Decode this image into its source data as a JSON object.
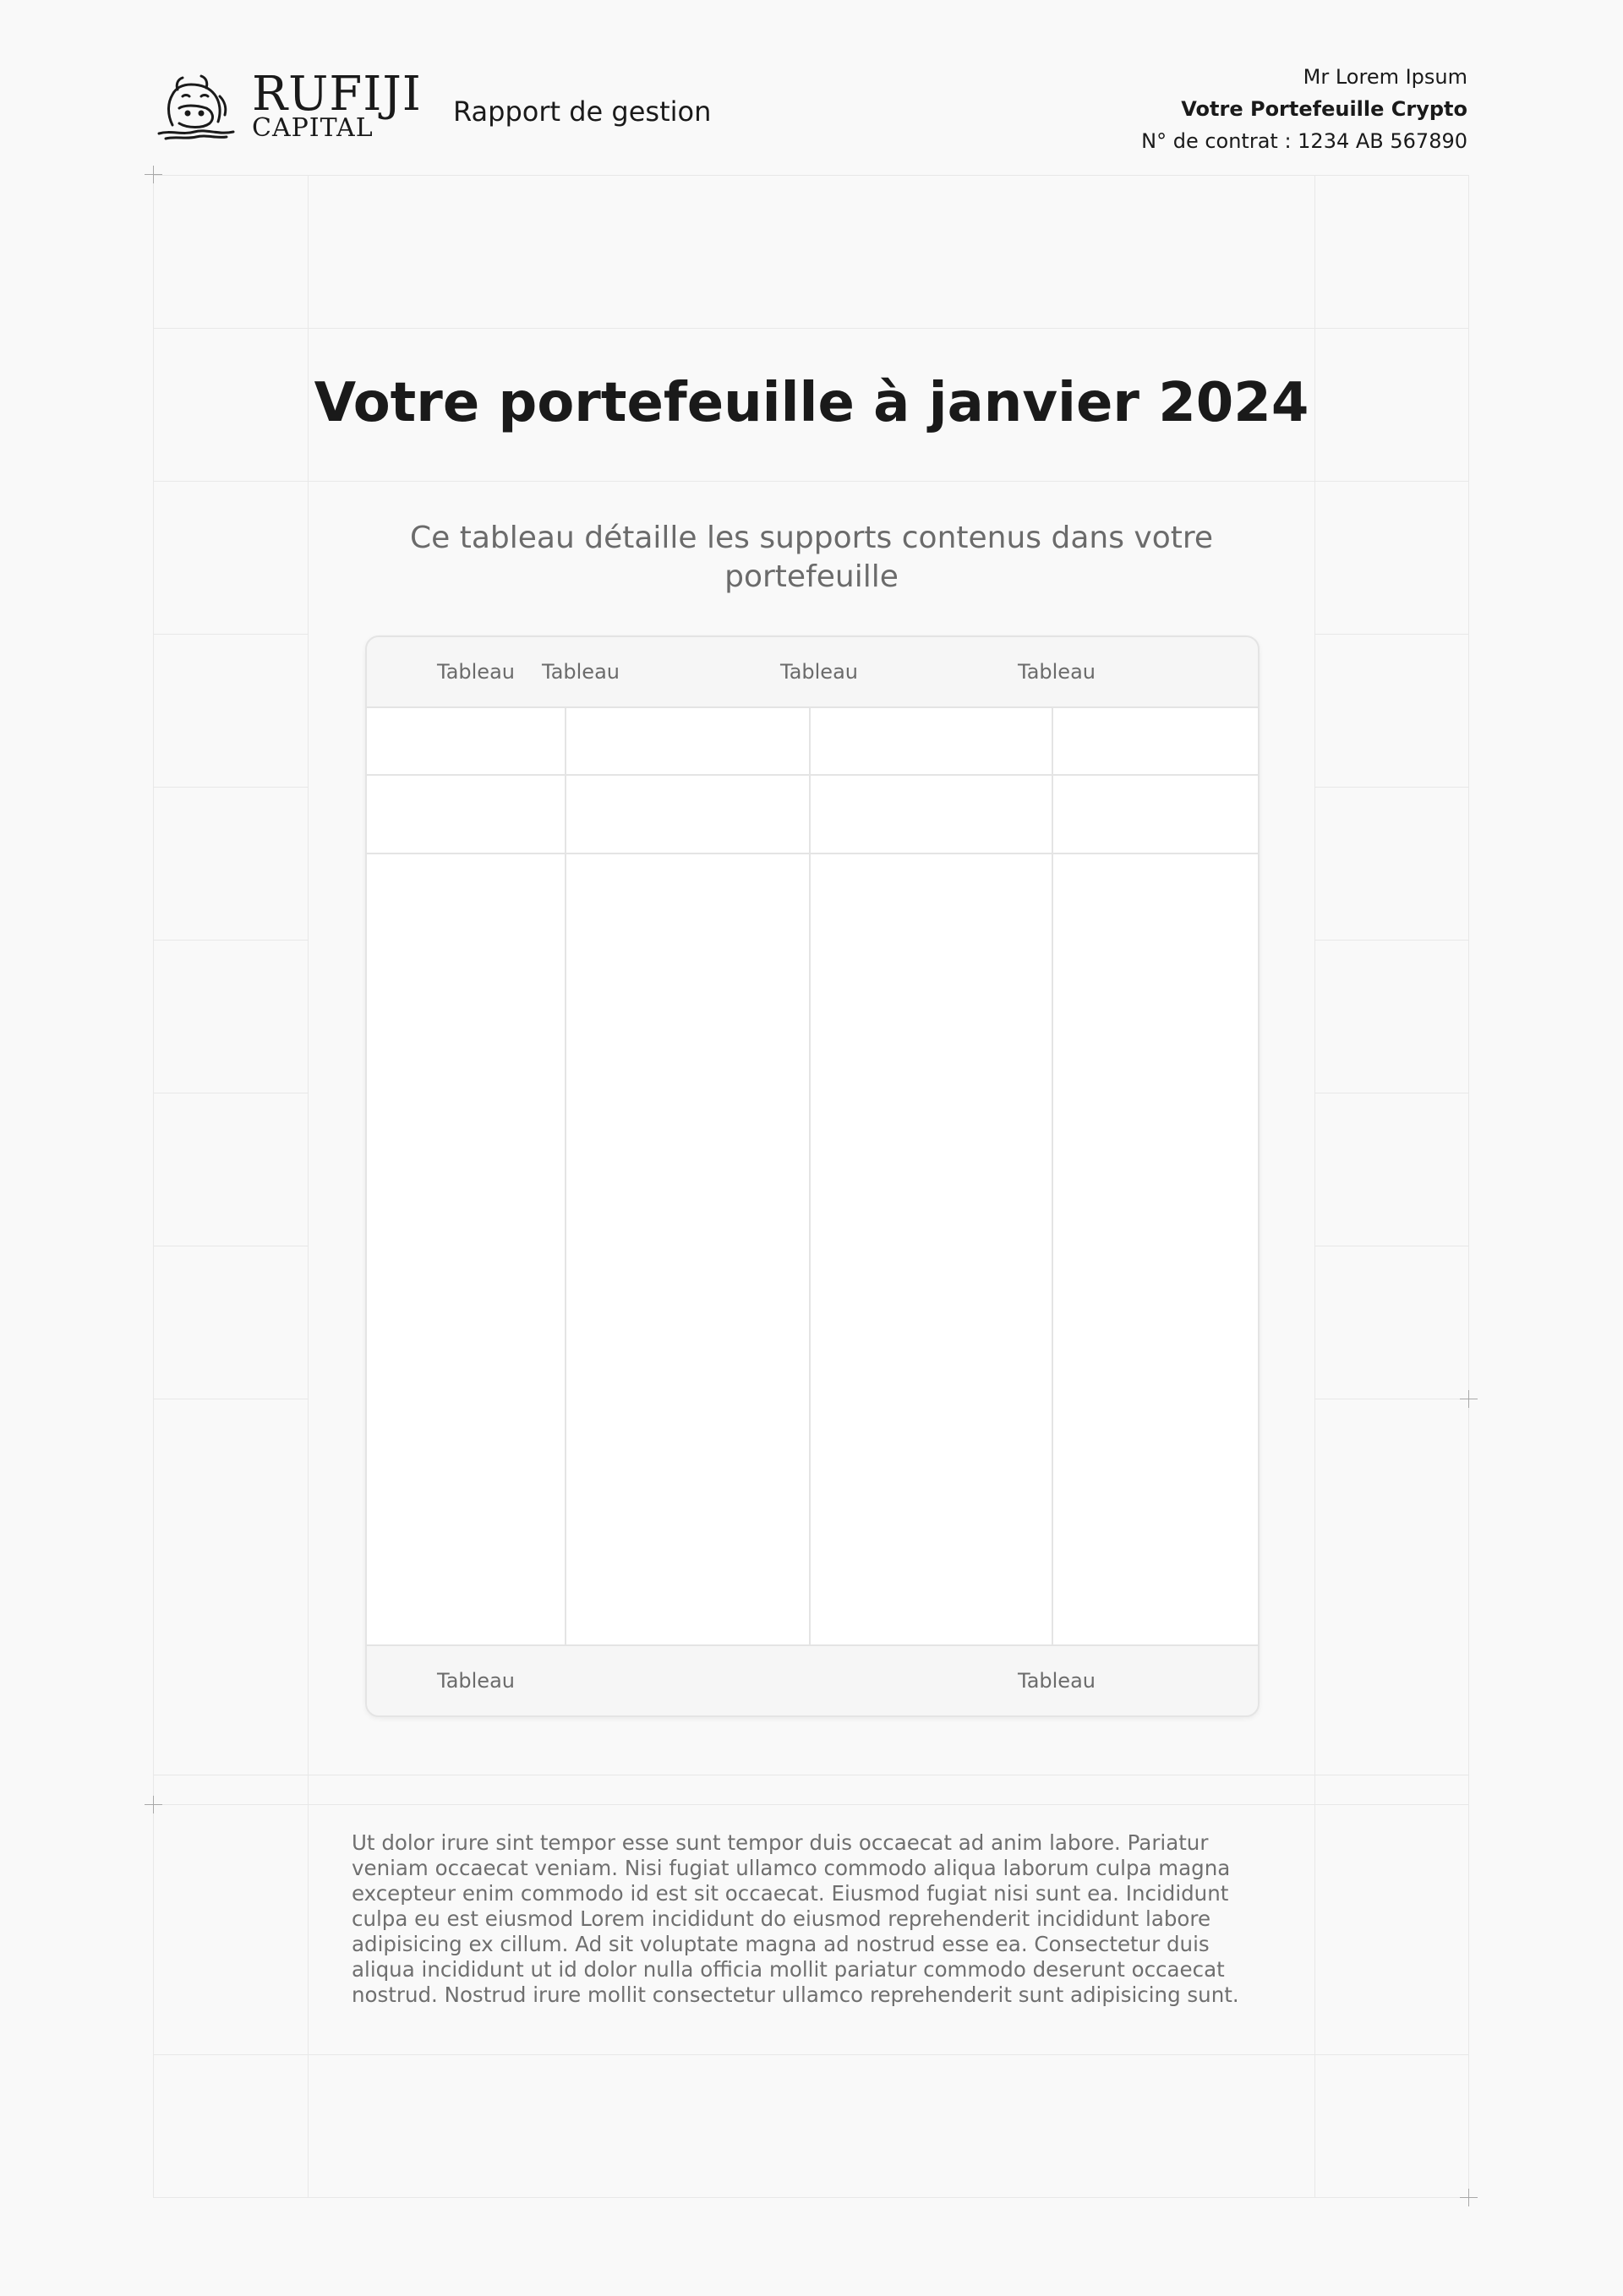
{
  "header": {
    "logo": {
      "word1": "RUFIJI",
      "word2": "CAPITAL",
      "icon": "hippo-logo-icon"
    },
    "report_label": "Rapport de gestion",
    "client": {
      "name": "Mr Lorem Ipsum",
      "portfolio": "Votre Portefeuille Crypto",
      "contract": "N° de contrat : 1234 AB 567890"
    }
  },
  "main": {
    "title": "Votre portefeuille à janvier 2024",
    "subtitle": "Ce tableau détaille les supports contenus dans votre portefeuille"
  },
  "table": {
    "headers": [
      "Tableau",
      "Tableau",
      "Tableau",
      "Tableau"
    ],
    "footer": {
      "left": "Tableau",
      "right": "Tableau"
    }
  },
  "body_text": "Ut dolor irure sint tempor esse sunt tempor duis occaecat ad anim labore. Pariatur veniam occaecat veniam. Nisi fugiat ullamco commodo aliqua laborum culpa magna excepteur enim commodo id est sit occaecat. Eiusmod fugiat nisi sunt ea. Incididunt culpa eu est eiusmod Lorem incididunt do eiusmod reprehenderit incididunt labore adipisicing ex cillum. Ad sit voluptate magna ad nostrud esse ea. Consectetur duis aliqua incididunt ut id dolor nulla officia mollit pariatur commodo deserunt occaecat nostrud. Nostrud irure mollit consectetur ullamco reprehenderit sunt adipisicing sunt."
}
